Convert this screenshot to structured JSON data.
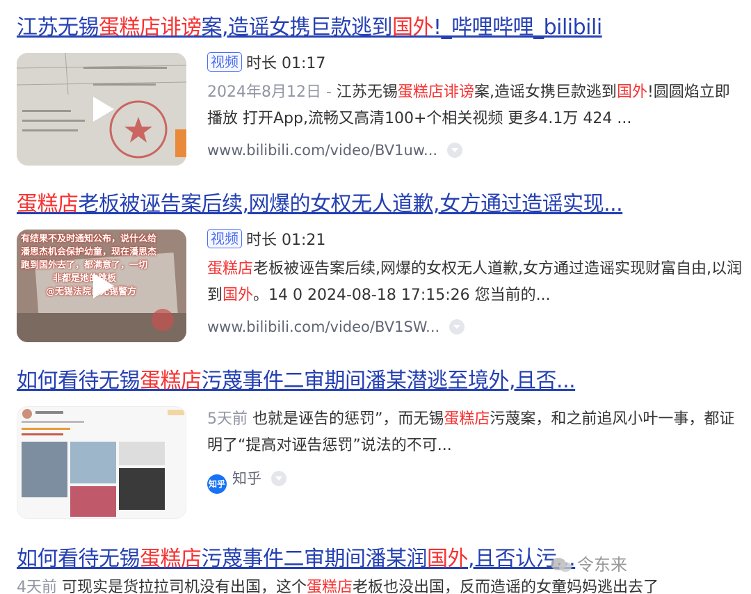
{
  "results": [
    {
      "title_parts": [
        "江苏无锡",
        "蛋糕店诽谤",
        "案,造谣女携巨款逃到",
        "国外",
        "!_哔哩哔哩_bilibili"
      ],
      "tag": "视频",
      "duration": "时长 01:17",
      "snippet_date": "2024年8月12日 - ",
      "snippet_parts": [
        "江苏无锡",
        "蛋糕店诽谤",
        "案,造谣女携巨款逃到",
        "国外",
        "!圆圆焰立即播放 打开App,流畅又高清100+个相关视频 更多4.1万 424 ..."
      ],
      "source": "www.bilibili.com/video/BV1uw..."
    },
    {
      "title_parts": [
        "蛋糕店",
        "老板被诬告案后续,网爆的女权无人道歉,女方通过造谣实现..."
      ],
      "tag": "视频",
      "duration": "时长 01:21",
      "snippet_parts": [
        "蛋糕店",
        "老板被诬告案后续,网爆的女权无人道歉,女方通过造谣实现财富自由,以润到",
        "国外",
        "。14 0 2024-08-18 17:15:26 您当前的..."
      ],
      "source": "www.bilibili.com/video/BV1SW...",
      "thumb_text": [
        "有结果不及时通知公布，说什么给",
        "潘思杰机会保护幼童，现在潘思杰",
        "跑到国外去了，都满意了，一切",
        "非都是她的跳板",
        "@无锡法院@无锡警方"
      ]
    },
    {
      "title_parts": [
        "如何看待无锡",
        "蛋糕店",
        "污蔑事件二审期间潘某潜逃至境外,且否..."
      ],
      "snippet_date": "5天前 ",
      "snippet_parts": [
        "也就是诬告的惩罚”，而无锡",
        "蛋糕店",
        "污蔑案，和之前追风小叶一事，都证明了“提高对诬告惩罚”说法的不可..."
      ],
      "source_logo": "知乎",
      "source": "知乎"
    },
    {
      "title_parts": [
        "如何看待无锡",
        "蛋糕店",
        "污蔑事件二审期间潘某润",
        "国外",
        ",且否认污..."
      ],
      "snippet_date": "4天前 ",
      "snippet_parts": [
        "可现实是货拉拉司机没有出国，这个",
        "蛋糕店",
        "老板也没出国，反而造谣的女童妈妈逃出去了"
      ]
    }
  ],
  "watermark": "令东来",
  "colors": {
    "link": "#2440b3",
    "highlight": "#f73131",
    "tag": "#4e6ef2",
    "muted": "#9195a3"
  }
}
